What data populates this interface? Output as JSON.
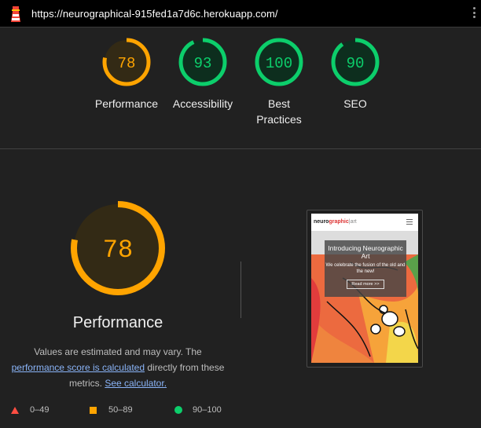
{
  "topbar": {
    "url": "https://neurographical-915fed1a7d6c.herokuapp.com/",
    "logo_icon": "lighthouse-icon",
    "menu_icon": "more-vert-icon"
  },
  "gauges": [
    {
      "score": "78",
      "label": "Performance",
      "color": "#ffa400",
      "bg": "#332a15",
      "fraction": 0.78
    },
    {
      "score": "93",
      "label": "Accessibility",
      "color": "#0cce6b",
      "bg": "#0d2e1e",
      "fraction": 0.93
    },
    {
      "score": "100",
      "label": "Best\nPractices",
      "color": "#0cce6b",
      "bg": "#0d2e1e",
      "fraction": 1.0
    },
    {
      "score": "90",
      "label": "SEO",
      "color": "#0cce6b",
      "bg": "#0d2e1e",
      "fraction": 0.9
    }
  ],
  "performance": {
    "score": "78",
    "title": "Performance",
    "desc_part1": "Values are estimated and may vary. The",
    "link1": "performance score is calculated",
    "desc_part2": " directly from these metrics. ",
    "link2": "See calculator."
  },
  "screenshot": {
    "brand_1": "neuro",
    "brand_2": "graphic",
    "brand_3": "|art",
    "hero_title": "Introducing Neurographic Art",
    "hero_text": "We celebrate the fusion of the old and the new!",
    "hero_button": "Read more >>"
  },
  "legend": {
    "fail": "0–49",
    "average": "50–89",
    "pass": "90–100"
  },
  "colors": {
    "pass": "#0cce6b",
    "average": "#ffa400",
    "fail": "#ff4e42",
    "link": "#8ab4f8"
  }
}
